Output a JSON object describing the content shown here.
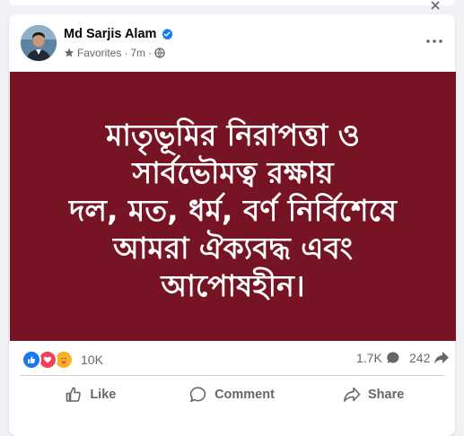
{
  "post": {
    "author_name": "Md Sarjis Alam",
    "audience": "Favorites",
    "separator": "·",
    "time": "7m",
    "image_text_lines": [
      "মাতৃভূমির নিরাপত্তা ও",
      "সার্বভৌমত্ব রক্ষায়",
      "দল, মত, ধর্ম, বর্ণ নির্বিশেষে",
      "আমরা ঐক্যবদ্ধ এবং",
      "আপোষহীন।"
    ],
    "image_background": "#771424"
  },
  "stats": {
    "reactions_count": "10K",
    "comments_count": "1.7K",
    "shares_count": "242"
  },
  "actions": {
    "like_label": "Like",
    "comment_label": "Comment",
    "share_label": "Share"
  },
  "colors": {
    "verified": "#1877f2",
    "like": "#1877f2",
    "love": "#f33e58",
    "care": "#f7b125",
    "secondary_text": "#65676b"
  }
}
